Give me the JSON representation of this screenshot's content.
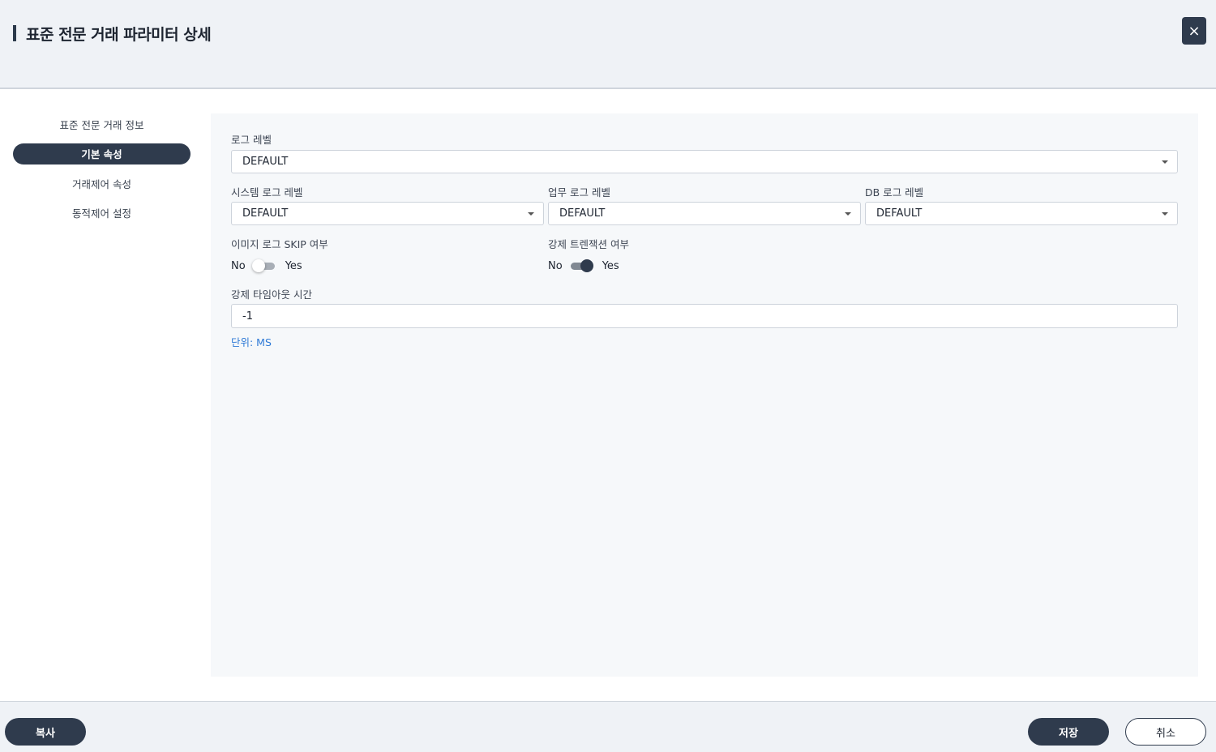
{
  "header": {
    "title": "표준 전문 거래 파라미터 상세",
    "close_icon": "×"
  },
  "sidebar": {
    "items": [
      {
        "label": "표준 전문 거래 정보",
        "active": false
      },
      {
        "label": "기본 속성",
        "active": true
      },
      {
        "label": "거래제어 속성",
        "active": false
      },
      {
        "label": "동적제어 설정",
        "active": false
      }
    ]
  },
  "form": {
    "log_level": {
      "label": "로그 레벨",
      "value": "DEFAULT"
    },
    "system_log_level": {
      "label": "시스템 로그 레벨",
      "value": "DEFAULT"
    },
    "business_log_level": {
      "label": "업무 로그 레벨",
      "value": "DEFAULT"
    },
    "db_log_level": {
      "label": "DB 로그 레벨",
      "value": "DEFAULT"
    },
    "image_log_skip": {
      "label": "이미지 로그 SKIP 여부",
      "no": "No",
      "yes": "Yes",
      "enabled": false
    },
    "force_transaction": {
      "label": "강제 트렌잭션 여부",
      "no": "No",
      "yes": "Yes",
      "enabled": true
    },
    "force_timeout": {
      "label": "강제 타임아웃 시간",
      "value": "-1",
      "hint": "단위: MS"
    }
  },
  "footer": {
    "copy_label": "복사",
    "save_label": "저장",
    "cancel_label": "취소"
  },
  "colors": {
    "primary": "#2f3b4d",
    "hint": "#2f7ad6",
    "header_bg": "#eff2f6"
  }
}
